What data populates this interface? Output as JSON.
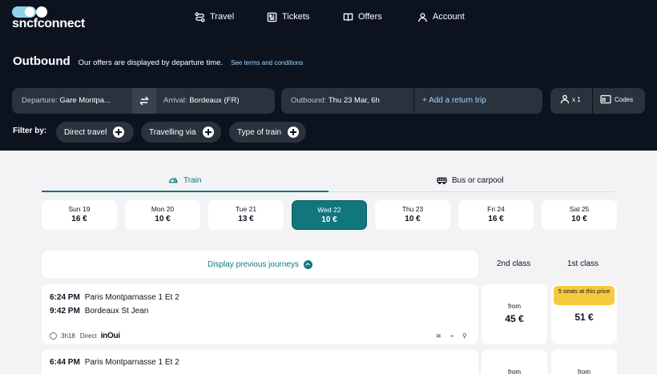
{
  "logo": {
    "text": "sncfconnect"
  },
  "nav": {
    "travel": "Travel",
    "tickets": "Tickets",
    "offers": "Offers",
    "account": "Account"
  },
  "heading": {
    "title": "Outbound",
    "subtitle": "Our offers are displayed by departure time.",
    "terms_link": "See terms and conditions"
  },
  "search": {
    "departure_label": "Departure:",
    "departure_value": "Gare Montpa...",
    "arrival_label": "Arrival:",
    "arrival_value": "Bordeaux (FR)",
    "outbound_label": "Outbound:",
    "outbound_value": "Thu 23 Mar, 6h",
    "return_trip": "+ Add a return trip",
    "passengers": "x 1",
    "codes": "Codes"
  },
  "filters": {
    "label": "Filter by:",
    "chips": [
      "Direct travel",
      "Travelling via",
      "Type of train"
    ]
  },
  "modes": {
    "train": "Train",
    "bus": "Bus or carpool",
    "active": "train"
  },
  "dates": [
    {
      "day": "Sun 19",
      "price": "16 €"
    },
    {
      "day": "Mon 20",
      "price": "10 €"
    },
    {
      "day": "Tue 21",
      "price": "13 €"
    },
    {
      "day": "Wed 22",
      "price": "10 €",
      "selected": true
    },
    {
      "day": "Thu 23",
      "price": "10 €"
    },
    {
      "day": "Fri 24",
      "price": "16 €"
    },
    {
      "day": "Sat 25",
      "price": "10 €"
    }
  ],
  "results": {
    "previous": "Display previous journeys",
    "class2": "2nd class",
    "class1": "1st class"
  },
  "journeys": [
    {
      "dep_time": "6:24 PM",
      "dep_station": "Paris Montparnasse 1 Et 2",
      "arr_time": "9:42 PM",
      "arr_station": "Bordeaux St Jean",
      "duration": "3h18",
      "type": "Direct",
      "brand": "inOui",
      "from_label": "from",
      "price_2nd": "45 €",
      "badge_1st": "5 seats at this price",
      "price_1st": "51 €"
    },
    {
      "dep_time": "6:44 PM",
      "dep_station": "Paris Montparnasse 1 Et 2",
      "from_label_2nd": "from",
      "from_label_1st": "from"
    }
  ],
  "colors": {
    "header_bg": "#0c131f",
    "accent": "#11767e",
    "badge": "#f7c940"
  }
}
